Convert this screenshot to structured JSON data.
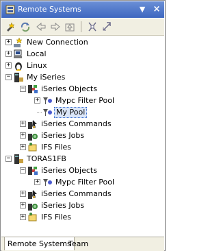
{
  "window": {
    "title": "Remote Systems",
    "menu_glyph": "▼",
    "close_glyph": "×"
  },
  "toolbar": {
    "buttons": [
      {
        "icon": "new-connection-icon"
      },
      {
        "icon": "refresh-icon"
      },
      {
        "icon": "back-icon"
      },
      {
        "icon": "forward-icon"
      },
      {
        "icon": "up-icon"
      },
      {
        "icon": "collapse-all-icon"
      },
      {
        "icon": "link-with-editor-icon"
      }
    ]
  },
  "tree": {
    "items": [
      {
        "label": "New Connection",
        "expander": "+",
        "icon": "new-connection-icon",
        "level": 0
      },
      {
        "label": "Local",
        "expander": "+",
        "icon": "local-system-icon",
        "level": 0
      },
      {
        "label": "Linux",
        "expander": "+",
        "icon": "linux-icon",
        "level": 0
      },
      {
        "label": "My iSeries",
        "expander": "−",
        "icon": "iseries-system-icon",
        "level": 0
      },
      {
        "label": "iSeries Objects",
        "expander": "−",
        "icon": "iseries-objects-icon",
        "level": 1
      },
      {
        "label": "Mypc Filter Pool",
        "expander": "+",
        "icon": "filter-pool-icon",
        "level": 2
      },
      {
        "label": "My Pool",
        "expander": "",
        "icon": "filter-pool-icon",
        "level": 2,
        "selected": true
      },
      {
        "label": "iSeries Commands",
        "expander": "+",
        "icon": "iseries-commands-icon",
        "level": 1
      },
      {
        "label": "iSeries Jobs",
        "expander": "+",
        "icon": "iseries-jobs-icon",
        "level": 1
      },
      {
        "label": "IFS Files",
        "expander": "+",
        "icon": "ifs-files-icon",
        "level": 1
      },
      {
        "label": "TORAS1FB",
        "expander": "−",
        "icon": "iseries-system-icon",
        "level": 0
      },
      {
        "label": "iSeries Objects",
        "expander": "−",
        "icon": "iseries-objects-icon",
        "level": 1
      },
      {
        "label": "Mypc Filter Pool",
        "expander": "+",
        "icon": "filter-pool-icon",
        "level": 2
      },
      {
        "label": "iSeries Commands",
        "expander": "+",
        "icon": "iseries-commands-icon",
        "level": 1
      },
      {
        "label": "iSeries Jobs",
        "expander": "+",
        "icon": "iseries-jobs-icon",
        "level": 1
      },
      {
        "label": "IFS Files",
        "expander": "+",
        "icon": "ifs-files-icon",
        "level": 1
      }
    ]
  },
  "tabs": [
    {
      "label": "Remote Systems",
      "active": true
    },
    {
      "label": "Team",
      "active": false
    }
  ],
  "colors": {
    "title_bar": "#3d67c0",
    "selection": "#dbe6f8",
    "toolbar_bg": "#f1efe2"
  }
}
